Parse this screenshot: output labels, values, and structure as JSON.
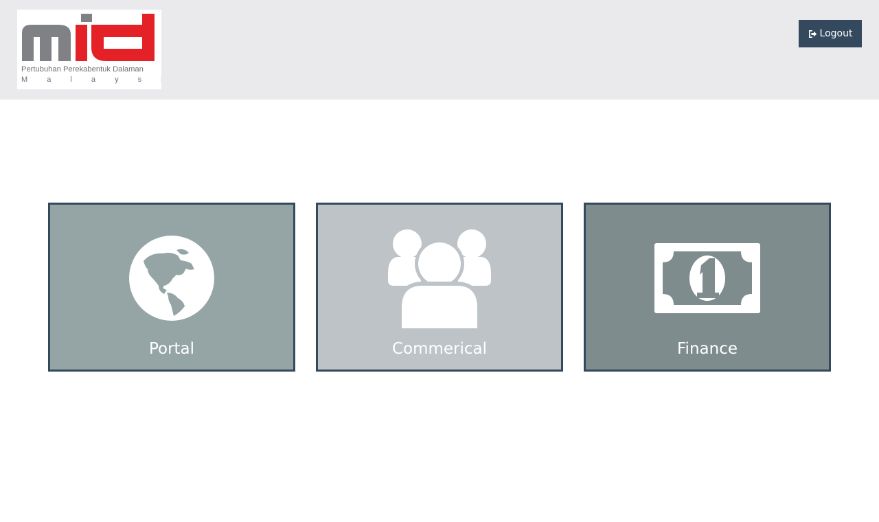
{
  "header": {
    "logo": {
      "text": "mid",
      "subtitle_line1": "Pertubuhan Perekabentuk Dalaman",
      "subtitle_line2": "M a l a y s i a"
    },
    "logout": {
      "label": "Logout",
      "icon": "sign-out-icon"
    }
  },
  "tiles": [
    {
      "label": "Portal",
      "icon": "globe-icon",
      "color": "#95a5a6"
    },
    {
      "label": "Commerical",
      "icon": "users-icon",
      "color": "#bdc3c7"
    },
    {
      "label": "Finance",
      "icon": "money-icon",
      "color": "#7f8c8d"
    }
  ],
  "colors": {
    "header_bg": "#eaeaec",
    "accent_dark": "#34495e",
    "logo_red": "#e42127",
    "logo_gray": "#808184"
  }
}
